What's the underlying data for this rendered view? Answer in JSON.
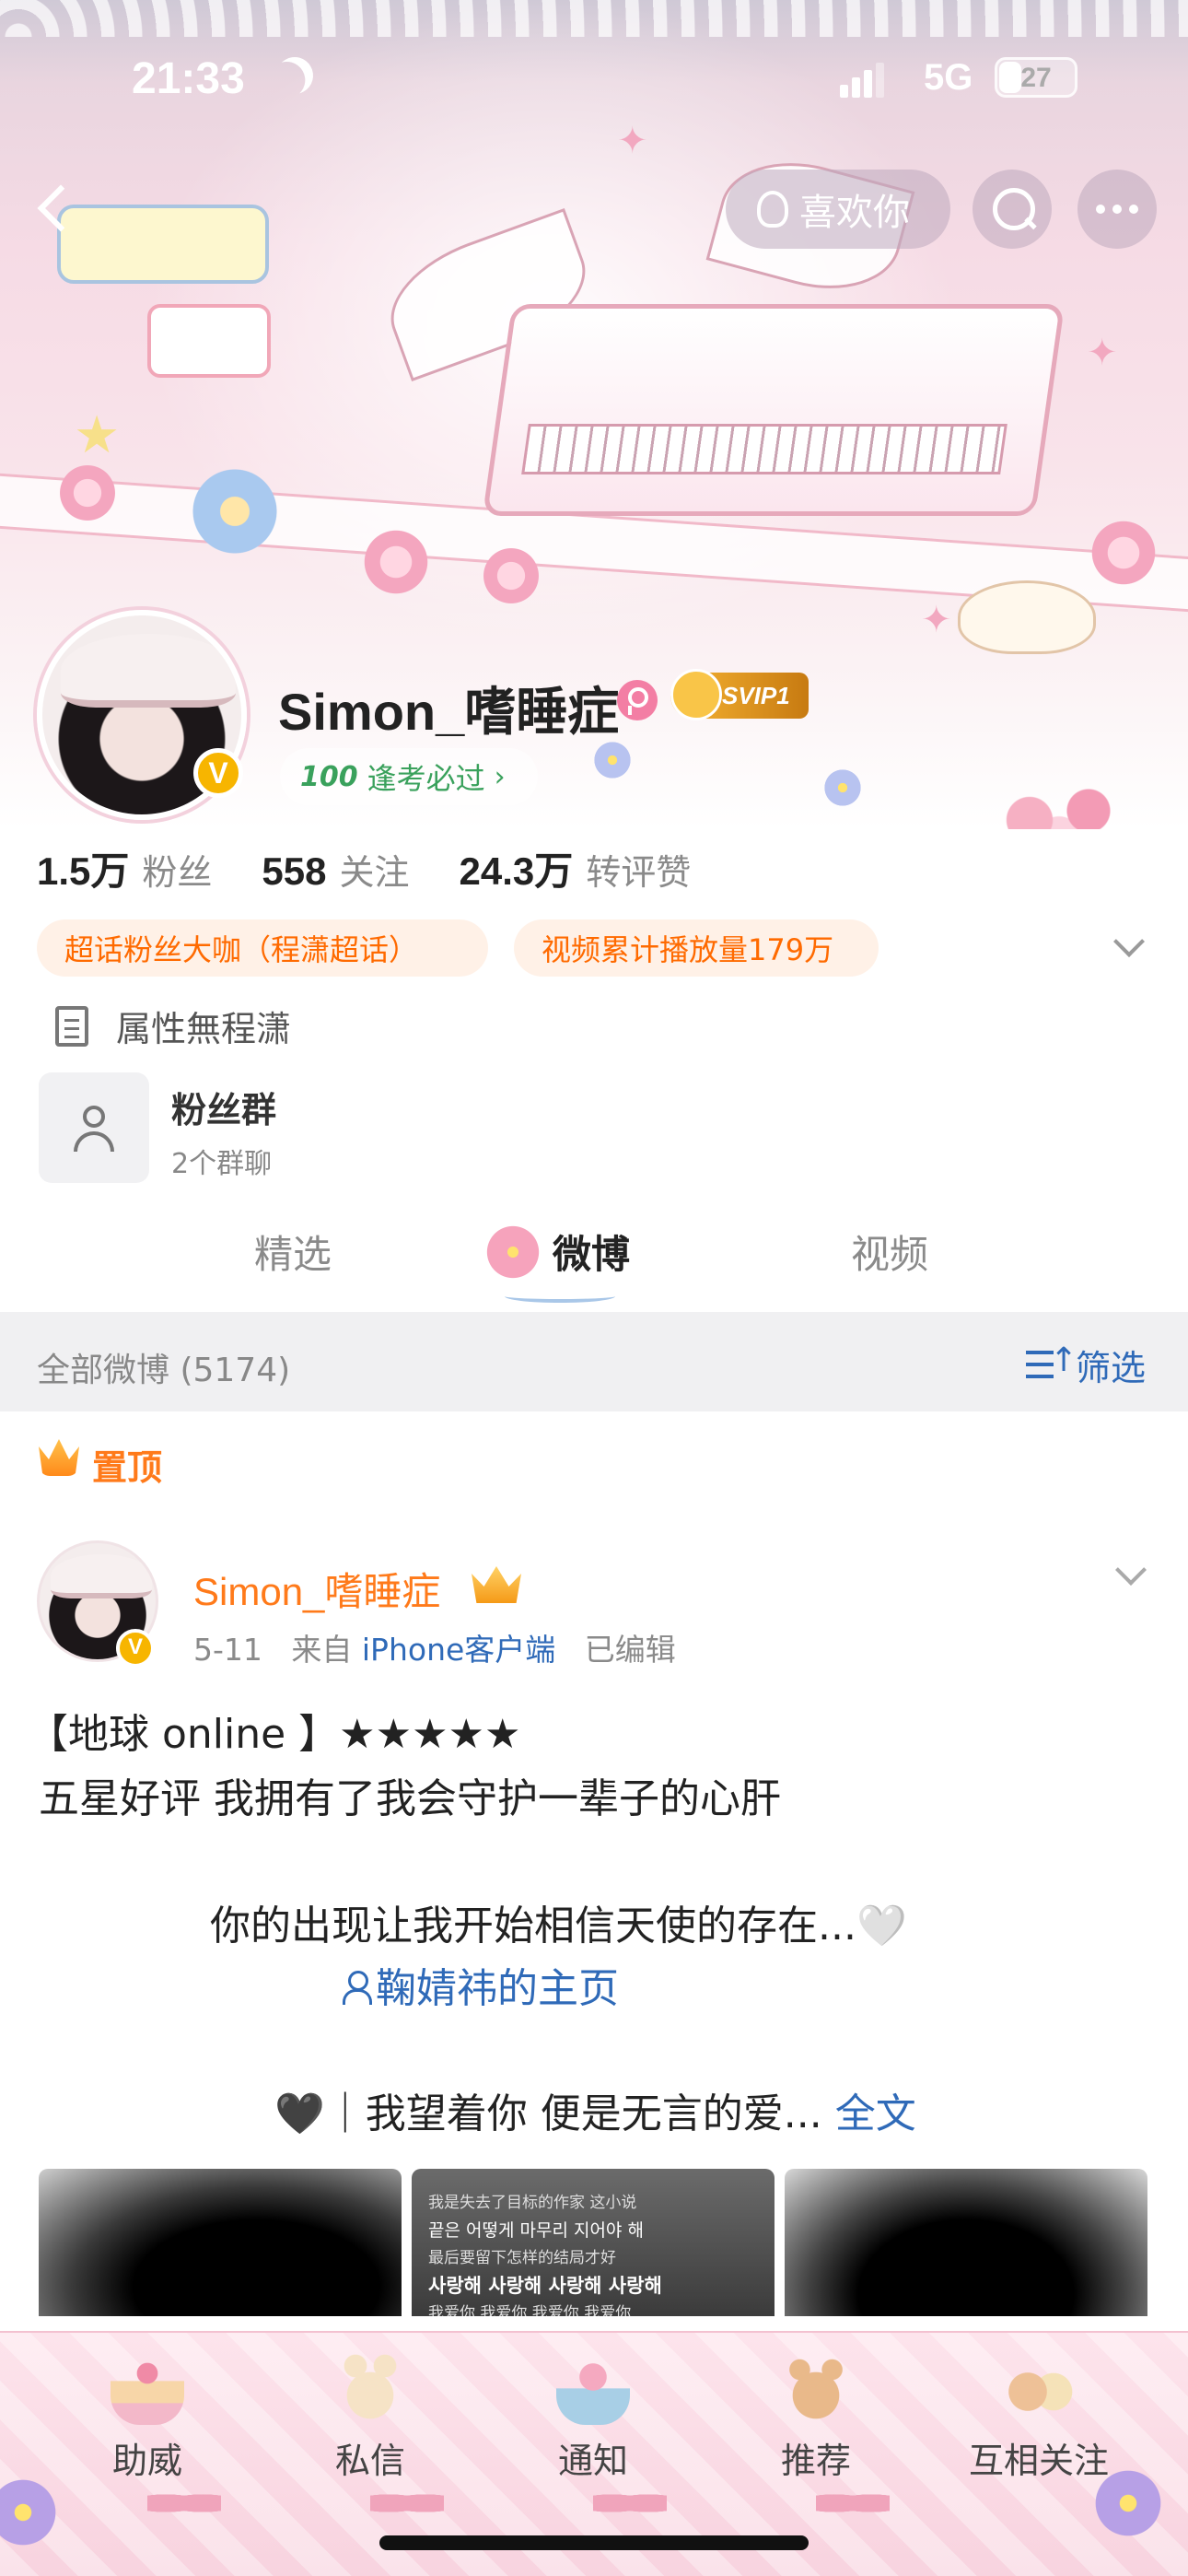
{
  "status_bar": {
    "time": "21:33",
    "network": "5G",
    "battery_level": "27",
    "icons": [
      "moon-icon",
      "signal-icon",
      "battery-icon"
    ]
  },
  "nav": {
    "like_label": "喜欢你",
    "icons": [
      "back-icon",
      "search-icon",
      "more-icon"
    ]
  },
  "profile": {
    "username": "Simon_嗜睡症",
    "svip": "SVIP1",
    "verified_badge": "V",
    "exam_tag": "逢考必过",
    "exam_icon_text": "100",
    "stats": [
      {
        "value": "1.5万",
        "label": "粉丝"
      },
      {
        "value": "558",
        "label": "关注"
      },
      {
        "value": "24.3万",
        "label": "转评赞"
      }
    ],
    "badges": [
      "超话粉丝大咖（程潇超话）",
      "视频累计播放量179万"
    ],
    "bio": "属性無程潇",
    "fan_group": {
      "title": "粉丝群",
      "subtitle": "2个群聊"
    }
  },
  "tabs": [
    {
      "label": "精选",
      "active": false
    },
    {
      "label": "微博",
      "active": true
    },
    {
      "label": "视频",
      "active": false
    }
  ],
  "filter_bar": {
    "all_posts": "全部微博 (5174)",
    "filter_label": "筛选"
  },
  "pinned": {
    "label": "置顶"
  },
  "post": {
    "author": "Simon_嗜睡症",
    "date": "5-11",
    "source_prefix": "来自",
    "source": "iPhone客户端",
    "edited": "已编辑",
    "lines": [
      "【地球 online 】★★★★★",
      "五星好评 我拥有了我会守护一辈子的心肝",
      "你的出现让我开始相信天使的存在...🤍",
      "鞠婧祎的主页",
      "🖤｜我望着你 便是无言的爱..."
    ],
    "more_label": "全文",
    "image_text": [
      "我是失去了目标的作家 这小说",
      "끝은 어떻게 마무리 지어야 해",
      "最后要留下怎样的结局才好",
      "사랑해 사랑해 사랑해 사랑해",
      "我爱你 我爱你 我爱你 我爱你"
    ]
  },
  "bottom_tabs": [
    {
      "label": "助威",
      "icon": "cake-icon"
    },
    {
      "label": "私信",
      "icon": "bunny-icon"
    },
    {
      "label": "通知",
      "icon": "bouquet-icon"
    },
    {
      "label": "推荐",
      "icon": "bear-icon"
    },
    {
      "label": "互相关注",
      "icon": "friends-icon"
    }
  ],
  "colors": {
    "accent_orange": "#ff7a1a",
    "link_blue": "#2f6ab8",
    "tag_green": "#3aa15c",
    "banner_pink": "#f6dbe5"
  }
}
